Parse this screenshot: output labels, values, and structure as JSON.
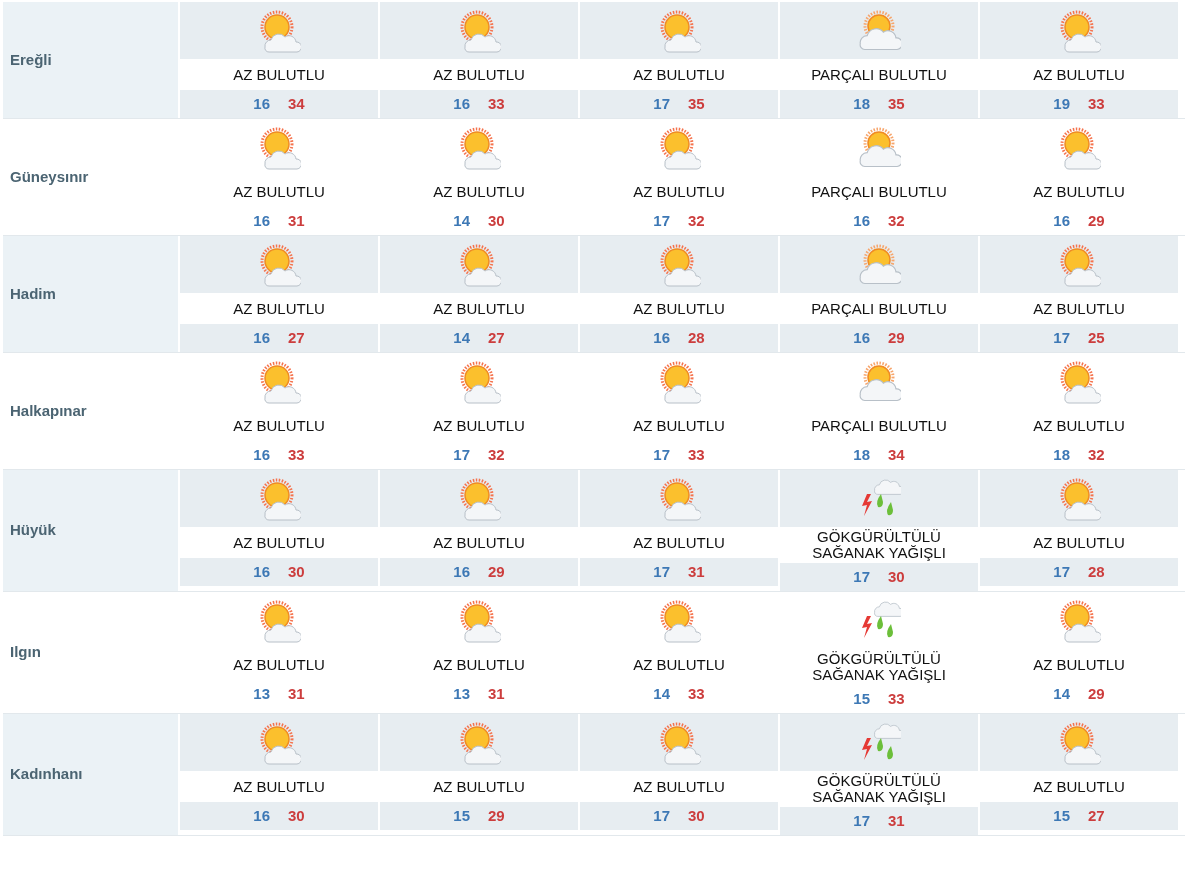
{
  "cities": [
    {
      "name": "Ereğli",
      "shaded": true,
      "days": [
        {
          "kind": "sun_cloud",
          "text": "AZ BULUTLU",
          "low": "16",
          "high": "34"
        },
        {
          "kind": "sun_cloud",
          "text": "AZ BULUTLU",
          "low": "16",
          "high": "33"
        },
        {
          "kind": "sun_cloud",
          "text": "AZ BULUTLU",
          "low": "17",
          "high": "35"
        },
        {
          "kind": "part_cloud",
          "text": "PARÇALI BULUTLU",
          "low": "18",
          "high": "35"
        },
        {
          "kind": "sun_cloud",
          "text": "AZ BULUTLU",
          "low": "19",
          "high": "33"
        }
      ]
    },
    {
      "name": "Güneysınır",
      "shaded": false,
      "days": [
        {
          "kind": "sun_cloud",
          "text": "AZ BULUTLU",
          "low": "16",
          "high": "31"
        },
        {
          "kind": "sun_cloud",
          "text": "AZ BULUTLU",
          "low": "14",
          "high": "30"
        },
        {
          "kind": "sun_cloud",
          "text": "AZ BULUTLU",
          "low": "17",
          "high": "32"
        },
        {
          "kind": "part_cloud",
          "text": "PARÇALI BULUTLU",
          "low": "16",
          "high": "32"
        },
        {
          "kind": "sun_cloud",
          "text": "AZ BULUTLU",
          "low": "16",
          "high": "29"
        }
      ]
    },
    {
      "name": "Hadim",
      "shaded": true,
      "days": [
        {
          "kind": "sun_cloud",
          "text": "AZ BULUTLU",
          "low": "16",
          "high": "27"
        },
        {
          "kind": "sun_cloud",
          "text": "AZ BULUTLU",
          "low": "14",
          "high": "27"
        },
        {
          "kind": "sun_cloud",
          "text": "AZ BULUTLU",
          "low": "16",
          "high": "28"
        },
        {
          "kind": "part_cloud",
          "text": "PARÇALI BULUTLU",
          "low": "16",
          "high": "29"
        },
        {
          "kind": "sun_cloud",
          "text": "AZ BULUTLU",
          "low": "17",
          "high": "25"
        }
      ]
    },
    {
      "name": "Halkapınar",
      "shaded": false,
      "days": [
        {
          "kind": "sun_cloud",
          "text": "AZ BULUTLU",
          "low": "16",
          "high": "33"
        },
        {
          "kind": "sun_cloud",
          "text": "AZ BULUTLU",
          "low": "17",
          "high": "32"
        },
        {
          "kind": "sun_cloud",
          "text": "AZ BULUTLU",
          "low": "17",
          "high": "33"
        },
        {
          "kind": "part_cloud",
          "text": "PARÇALI BULUTLU",
          "low": "18",
          "high": "34"
        },
        {
          "kind": "sun_cloud",
          "text": "AZ BULUTLU",
          "low": "18",
          "high": "32"
        }
      ]
    },
    {
      "name": "Hüyük",
      "shaded": true,
      "days": [
        {
          "kind": "sun_cloud",
          "text": "AZ BULUTLU",
          "low": "16",
          "high": "30"
        },
        {
          "kind": "sun_cloud",
          "text": "AZ BULUTLU",
          "low": "16",
          "high": "29"
        },
        {
          "kind": "sun_cloud",
          "text": "AZ BULUTLU",
          "low": "17",
          "high": "31"
        },
        {
          "kind": "thunder",
          "text": "GÖKGÜRÜLTÜLÜ SAĞANAK YAĞIŞLI",
          "low": "17",
          "high": "30"
        },
        {
          "kind": "sun_cloud",
          "text": "AZ BULUTLU",
          "low": "17",
          "high": "28"
        }
      ]
    },
    {
      "name": "Ilgın",
      "shaded": false,
      "days": [
        {
          "kind": "sun_cloud",
          "text": "AZ BULUTLU",
          "low": "13",
          "high": "31"
        },
        {
          "kind": "sun_cloud",
          "text": "AZ BULUTLU",
          "low": "13",
          "high": "31"
        },
        {
          "kind": "sun_cloud",
          "text": "AZ BULUTLU",
          "low": "14",
          "high": "33"
        },
        {
          "kind": "thunder",
          "text": "GÖKGÜRÜLTÜLÜ SAĞANAK YAĞIŞLI",
          "low": "15",
          "high": "33"
        },
        {
          "kind": "sun_cloud",
          "text": "AZ BULUTLU",
          "low": "14",
          "high": "29"
        }
      ]
    },
    {
      "name": "Kadınhanı",
      "shaded": true,
      "days": [
        {
          "kind": "sun_cloud",
          "text": "AZ BULUTLU",
          "low": "16",
          "high": "30"
        },
        {
          "kind": "sun_cloud",
          "text": "AZ BULUTLU",
          "low": "15",
          "high": "29"
        },
        {
          "kind": "sun_cloud",
          "text": "AZ BULUTLU",
          "low": "17",
          "high": "30"
        },
        {
          "kind": "thunder",
          "text": "GÖKGÜRÜLTÜLÜ SAĞANAK YAĞIŞLI",
          "low": "17",
          "high": "31"
        },
        {
          "kind": "sun_cloud",
          "text": "AZ BULUTLU",
          "low": "15",
          "high": "27"
        }
      ]
    }
  ]
}
